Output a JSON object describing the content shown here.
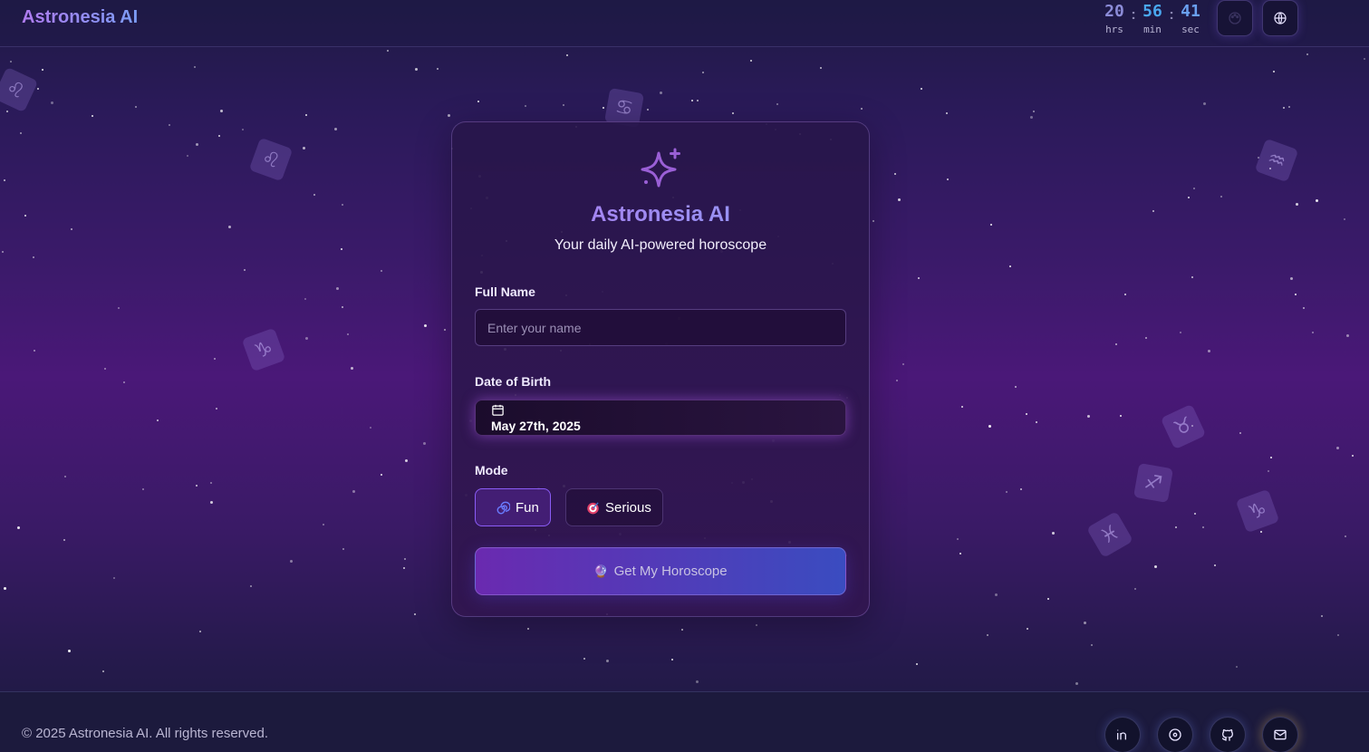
{
  "header": {
    "brand": "Astronesia AI",
    "clock": {
      "hours": "20",
      "hours_label": "hrs",
      "minutes": "56",
      "minutes_label": "min",
      "seconds": "41",
      "seconds_label": "sec"
    },
    "buttons": [
      {
        "icon": "palette-icon"
      },
      {
        "icon": "globe-icon"
      }
    ]
  },
  "background": {
    "zodiac_symbols": [
      "♌",
      "♌",
      "♋",
      "♑",
      "♒",
      "♉",
      "♐",
      "♑",
      "♓"
    ]
  },
  "card": {
    "icon": "sparkles-icon",
    "title": "Astronesia AI",
    "subtitle": "Your daily AI-powered horoscope",
    "name_label": "Full Name",
    "name_value": "",
    "name_placeholder": "Enter your name",
    "dob_label": "Date of Birth",
    "dob_value": "May 27th, 2025",
    "mode_label": "Mode",
    "modes": [
      {
        "label": "Fun",
        "icon": "spiral-icon",
        "selected": true
      },
      {
        "label": "Serious",
        "icon": "target-icon",
        "selected": false
      }
    ],
    "cta_icon": "🔮",
    "cta_label": "Get My Horoscope"
  },
  "footer": {
    "copyright": "© 2025 Astronesia AI. All rights reserved.",
    "social": [
      {
        "icon": "linkedin-icon"
      },
      {
        "icon": "disc-icon"
      },
      {
        "icon": "github-icon"
      },
      {
        "icon": "mail-icon"
      }
    ]
  },
  "colors": {
    "accent": "#8b5cf6",
    "brand_gradient_start": "#b07bf0",
    "brand_gradient_end": "#7b9cf5",
    "clock_hours": "#8c8cd8",
    "clock_minutes": "#4aa8f0",
    "clock_seconds": "#6aa0f0"
  }
}
